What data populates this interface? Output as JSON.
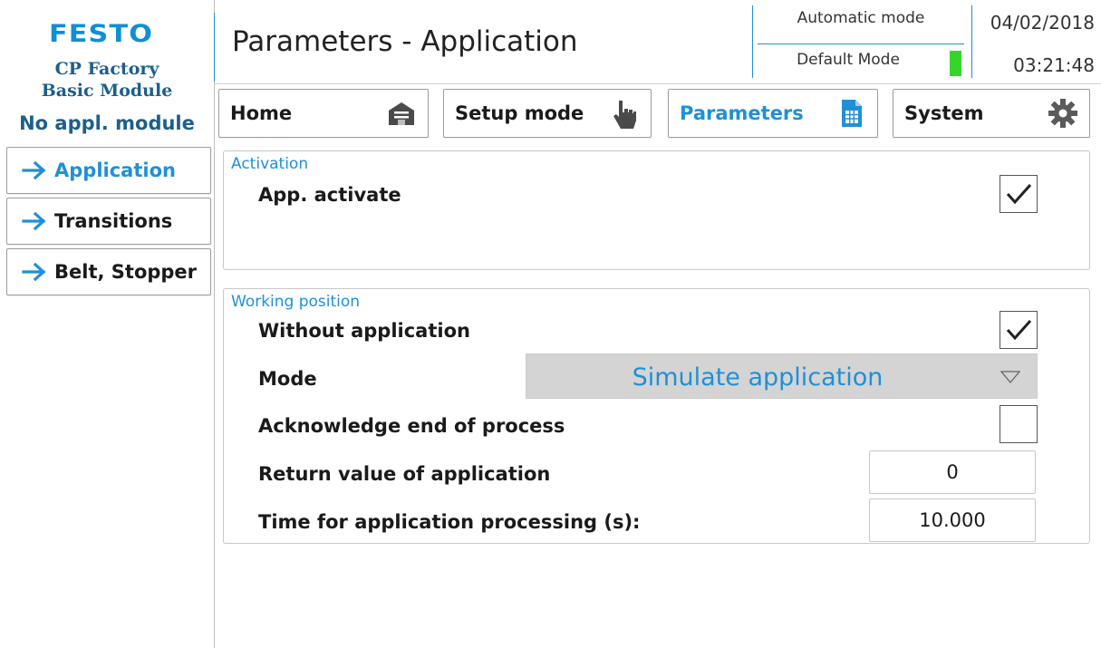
{
  "brand": {
    "logo_text": "FESTO",
    "station_line1": "CP Factory",
    "station_line2": "Basic Module",
    "module_status": "No appl. module"
  },
  "side_nav": {
    "items": [
      {
        "label": "Application",
        "active": true
      },
      {
        "label": "Transitions",
        "active": false
      },
      {
        "label": "Belt, Stopper",
        "active": false
      }
    ]
  },
  "header": {
    "title": "Parameters - Application",
    "mode": "Automatic mode",
    "sub_mode": "Default Mode",
    "date": "04/02/2018",
    "time": "03:21:48",
    "status_led_color": "#34d62a"
  },
  "tabs": [
    {
      "label": "Home",
      "icon": "home-icon"
    },
    {
      "label": "Setup mode",
      "icon": "hand-pointer-icon"
    },
    {
      "label": "Parameters",
      "icon": "document-table-icon",
      "active": true
    },
    {
      "label": "System",
      "icon": "gear-icon"
    }
  ],
  "activation": {
    "title": "Activation",
    "app_activate_label": "App. activate",
    "app_activate_checked": true
  },
  "working_position": {
    "title": "Working position",
    "without_application_label": "Without application",
    "without_application_checked": true,
    "mode_label": "Mode",
    "mode_value": "Simulate application",
    "ack_label": "Acknowledge end of process",
    "ack_checked": false,
    "return_value_label": "Return value of application",
    "return_value": "0",
    "time_label": "Time for application processing (s):",
    "time_value": "10.000"
  },
  "colors": {
    "accent": "#1f90d6",
    "brand_blue": "#0f8fd4",
    "station_text": "#1c5f8c"
  }
}
